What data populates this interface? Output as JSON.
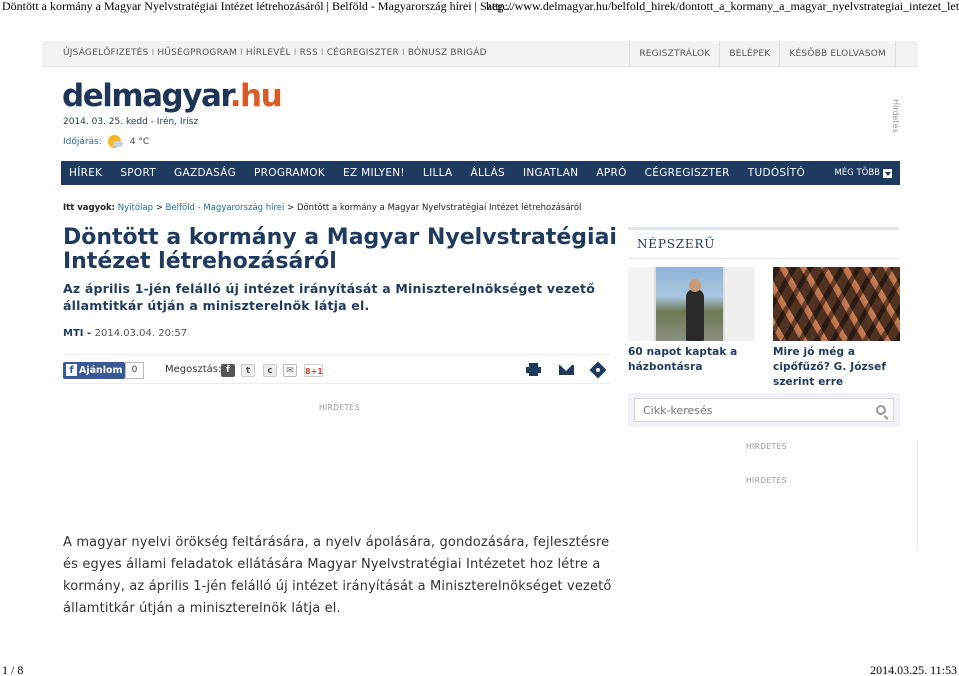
{
  "print_header": {
    "title": "Döntött a kormány a Magyar Nyelvstratégiai Intézet létrehozásáról | Belföld - Magyarország hírei | Szeg...",
    "url": "http://www.delmagyar.hu/belfold_hirek/dontott_a_kormany_a_magyar_nyelvstrategiai_intezet_letrehoz..."
  },
  "print_footer": {
    "page": "1 / 8",
    "datetime": "2014.03.25. 11:53"
  },
  "topbar": {
    "left_links": [
      "ÚJSÁGELŐFIZETÉS",
      "HŰSÉGPROGRAM",
      "HÍRLEVÉL",
      "RSS",
      "CÉGREGISZTER",
      "BÓNUSZ BRIGÁD"
    ],
    "separator": "I",
    "right_links": [
      "REGISZTRÁLOK",
      "BELÉPEK",
      "KÉSŐBB ELOLVASOM"
    ]
  },
  "logo": {
    "part1": "delmagyar",
    "dot": ".",
    "part2": "hu"
  },
  "date_line": "2014. 03. 25. kedd - Irén, Irisz",
  "weather": {
    "label": "Időjárás:",
    "temp": "4 °C",
    "icon": "partly-sunny-icon"
  },
  "side_ad_label": "Hirdetés",
  "nav": {
    "items": [
      "HÍREK",
      "SPORT",
      "GAZDASÁG",
      "PROGRAMOK",
      "EZ MILYEN!",
      "LILLA",
      "ÁLLÁS",
      "INGATLAN",
      "APRÓ",
      "CÉGREGISZTER",
      "TUDÓSÍTÓ"
    ],
    "more": "MÉG TÖBB"
  },
  "breadcrumb": {
    "prefix": "Itt vagyok:",
    "home": "Nyitólap",
    "sep": ">",
    "section": "Belföld - Magyarország hírei",
    "current": "Döntött a kormány a Magyar Nyelvstratégiai Intézet létrehozásáról"
  },
  "article": {
    "title": "Döntött a kormány a Magyar Nyelvstratégiai Intézet létrehozásáról",
    "lead": "Az április 1-jén felálló új intézet irányítását a Miniszterelnökséget vezető államtitkár útján a miniszterelnök látja el.",
    "source": "MTI",
    "dash": " - ",
    "date": "2014.03.04. 20:57",
    "body": "A magyar nyelvi örökség feltárására, a nyelv ápolására, gondozására, fejlesztésre és egyes állami feladatok ellátására Magyar Nyelvstratégiai Intézetet hoz létre a kormány, az április 1-jén felálló új intézet irányítását a Miniszterelnökséget vezető államtitkár útján a miniszterelnök látja el."
  },
  "share": {
    "fb_label": "Ajánlom",
    "fb_count": "0",
    "share_label": "Megosztás:",
    "gplus": "8+1",
    "icons": [
      "facebook-icon",
      "twitter-icon",
      "c-icon",
      "mail-icon",
      "gplus-icon",
      "print-icon",
      "envelope-icon",
      "tag-icon"
    ]
  },
  "ad_labels": {
    "article": "HIRDETÉS",
    "side1": "HIRDETÉS",
    "side2": "HIRDETÉS"
  },
  "sidebar": {
    "popular_title": "NÉPSZERŰ",
    "items": [
      {
        "caption": "60 napot kaptak a házbontásra"
      },
      {
        "caption": "Mire jó még a cipőfűző? G. József szerint erre"
      }
    ],
    "search_placeholder": "Cikk-keresés"
  }
}
